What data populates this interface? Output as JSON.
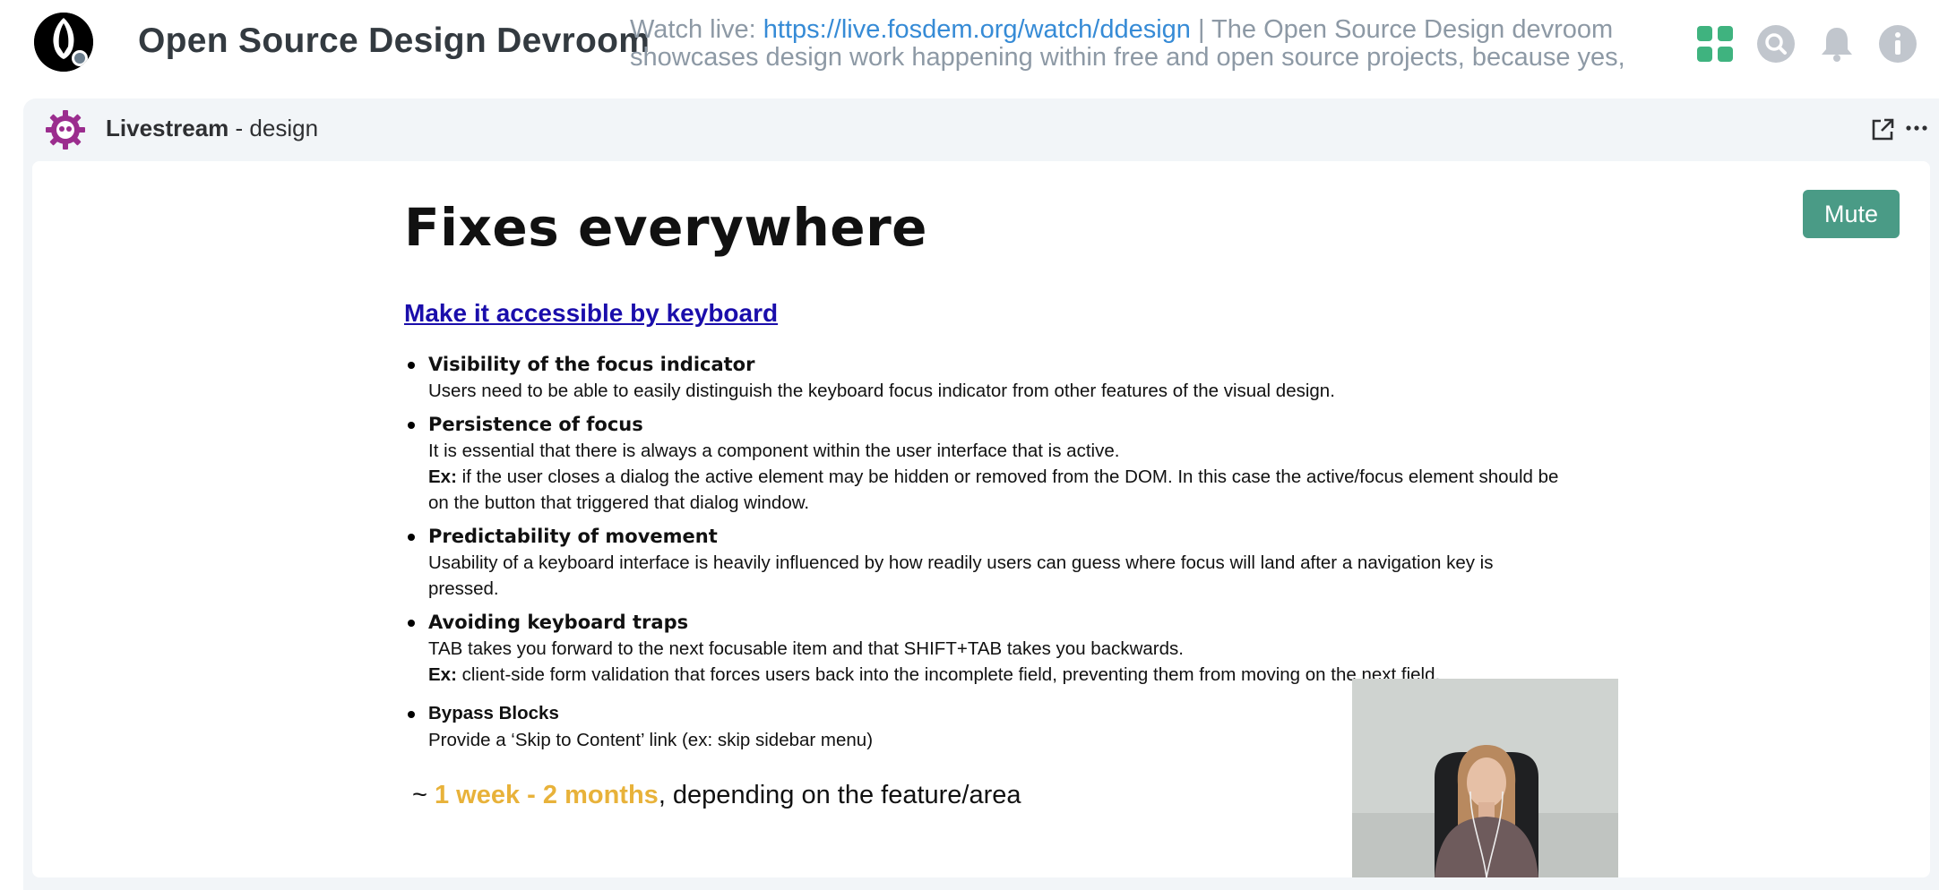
{
  "room": {
    "name": "Open Source Design Devroom",
    "topic_prefix": "Watch live: ",
    "topic_link": "https://live.fosdem.org/watch/ddesign",
    "topic_rest": " | The Open Source Design devroom showcases design work happening within free and open source projects, because yes, there is"
  },
  "header_icons": [
    "apps-grid-icon",
    "search-icon",
    "bell-icon",
    "info-icon"
  ],
  "widget": {
    "title_bold": "Livestream",
    "title_rest": " - design",
    "icons": [
      "popout-icon",
      "more-options-icon"
    ]
  },
  "slide": {
    "title": "Fixes everywhere",
    "link": "Make it accessible by keyboard",
    "items": [
      {
        "heading": "Visibility of the focus indicator",
        "lines": [
          "Users need to be able to easily distinguish the keyboard focus indicator from other features of the visual design."
        ]
      },
      {
        "heading": "Persistence of focus",
        "lines": [
          "It is essential that there is always a component within the user interface that is active."
        ],
        "ex_label": "Ex:",
        "ex_text": " if the user closes a dialog the active element may be hidden or removed from the DOM. In this case the active/focus element should be on the button that triggered that dialog window."
      },
      {
        "heading": "Predictability of movement",
        "lines": [
          "Usability of a keyboard interface is heavily influenced by how readily users can guess where focus will land after a navigation key is pressed."
        ]
      },
      {
        "heading": "Avoiding keyboard traps",
        "lines": [
          "TAB takes you forward to the next focusable item and that SHIFT+TAB takes you backwards."
        ],
        "ex_label": "Ex:",
        "ex_text": " client-side form validation that forces users back into the incomplete field, preventing them from moving on the next field."
      },
      {
        "heading": "Bypass Blocks",
        "lines": [
          "Provide a ‘Skip to Content’ link (ex: skip sidebar menu)"
        ]
      }
    ],
    "estimate_prefix": "~ ",
    "estimate_highlight": "1 week - 2 months",
    "estimate_rest": ", depending on the feature/area"
  },
  "mute_label": "Mute",
  "colors": {
    "accent": "#4a9b86",
    "highlight": "#e8b23a",
    "link": "#368bd6"
  }
}
